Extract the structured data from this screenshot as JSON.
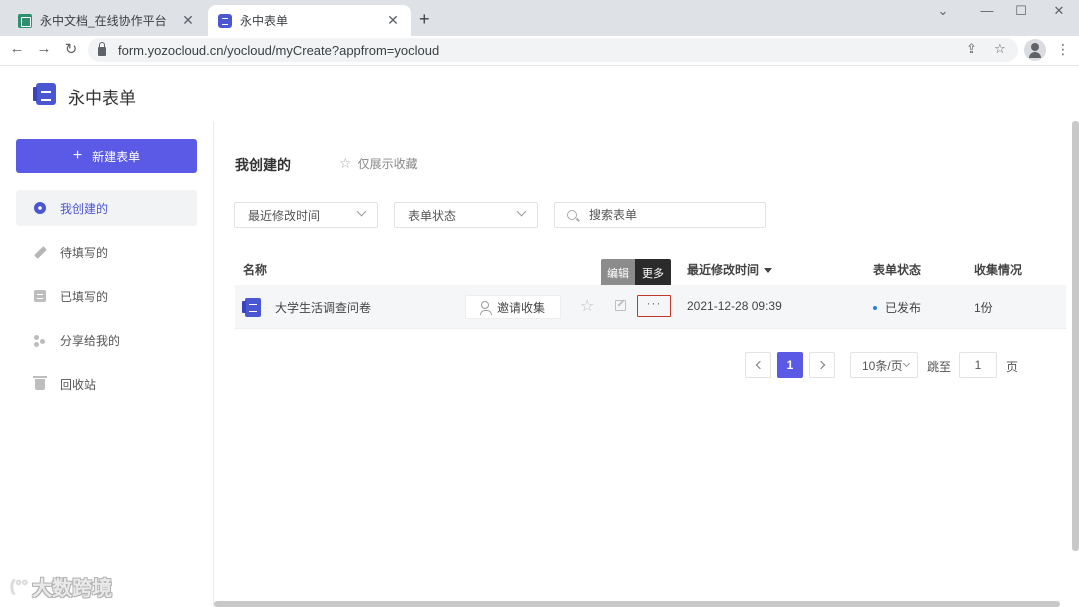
{
  "browser": {
    "tabs": [
      {
        "title": "永中文档_在线协作平台",
        "favicon": "doc-icon",
        "active": false
      },
      {
        "title": "永中表单",
        "favicon": "form-icon",
        "active": true
      }
    ],
    "url": "form.yozocloud.cn/yocloud/myCreate?appfrom=yocloud"
  },
  "app": {
    "title": "永中表单"
  },
  "sidebar": {
    "new_button_label": "新建表单",
    "items": [
      {
        "label": "我创建的",
        "icon": "my-created-icon",
        "active": true
      },
      {
        "label": "待填写的",
        "icon": "pencil-icon",
        "active": false
      },
      {
        "label": "已填写的",
        "icon": "filled-form-icon",
        "active": false
      },
      {
        "label": "分享给我的",
        "icon": "share-icon",
        "active": false
      },
      {
        "label": "回收站",
        "icon": "trash-icon",
        "active": false
      }
    ]
  },
  "main": {
    "title": "我创建的",
    "favorites_filter_label": "仅展示收藏",
    "filters": {
      "sort_select": "最近修改时间",
      "status_select": "表单状态",
      "search_placeholder": "搜索表单"
    },
    "table": {
      "headers": {
        "name": "名称",
        "modified": "最近修改时间",
        "status": "表单状态",
        "collected": "收集情况"
      },
      "rows": [
        {
          "name": "大学生活调查问卷",
          "invite_label": "邀请收集",
          "more_label": "···",
          "modified": "2021-12-28 09:39",
          "status": "已发布",
          "collected": "1份"
        }
      ]
    },
    "tooltip": {
      "edit": "编辑",
      "more": "更多"
    },
    "pagination": {
      "current_page": "1",
      "page_size": "10条/页",
      "jump_label": "跳至",
      "jump_value": "1",
      "page_unit": "页"
    }
  },
  "watermark": {
    "logo": "(°°",
    "text": "大数跨境"
  },
  "colors": {
    "accent": "#5a5ae6",
    "status_published_dot": "#2a7de1",
    "highlight_border": "#c0392b"
  }
}
